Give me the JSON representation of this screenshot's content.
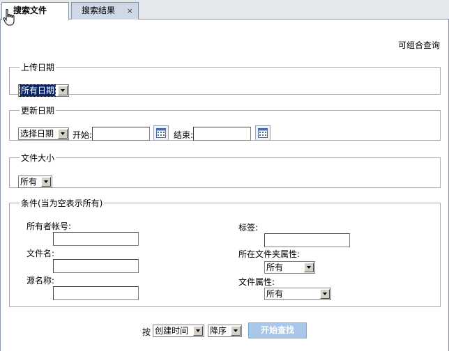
{
  "tabs": [
    {
      "label": "搜索文件",
      "active": true
    },
    {
      "label": "搜索结果",
      "active": false,
      "close": "×"
    }
  ],
  "hint": "可组合查询",
  "upload": {
    "legend": "上传日期",
    "select_value": "所有日期"
  },
  "update": {
    "legend": "更新日期",
    "select_value": "选择日期",
    "start_label": "开始:",
    "start_value": "",
    "end_label": "结束:",
    "end_value": ""
  },
  "size": {
    "legend": "文件大小",
    "select_value": "所有"
  },
  "conditions": {
    "legend": "条件(当为空表示所有)",
    "owner_label": "所有者帐号:",
    "filename_label": "文件名:",
    "source_label": "源名称:",
    "tag_label": "标签:",
    "folder_attr_label": "所在文件夹属性:",
    "folder_attr_value": "所有",
    "file_attr_label": "文件属性:",
    "file_attr_value": "所有"
  },
  "sort": {
    "by_label": "按",
    "field_value": "创建时间",
    "order_value": "降序",
    "search_button": "开始查找"
  },
  "colors": {
    "tab_bar": "#e4e7ec",
    "inactive_tab": "#cfd8e6",
    "button": "#a9c7e8",
    "border": "#8a96a8"
  }
}
